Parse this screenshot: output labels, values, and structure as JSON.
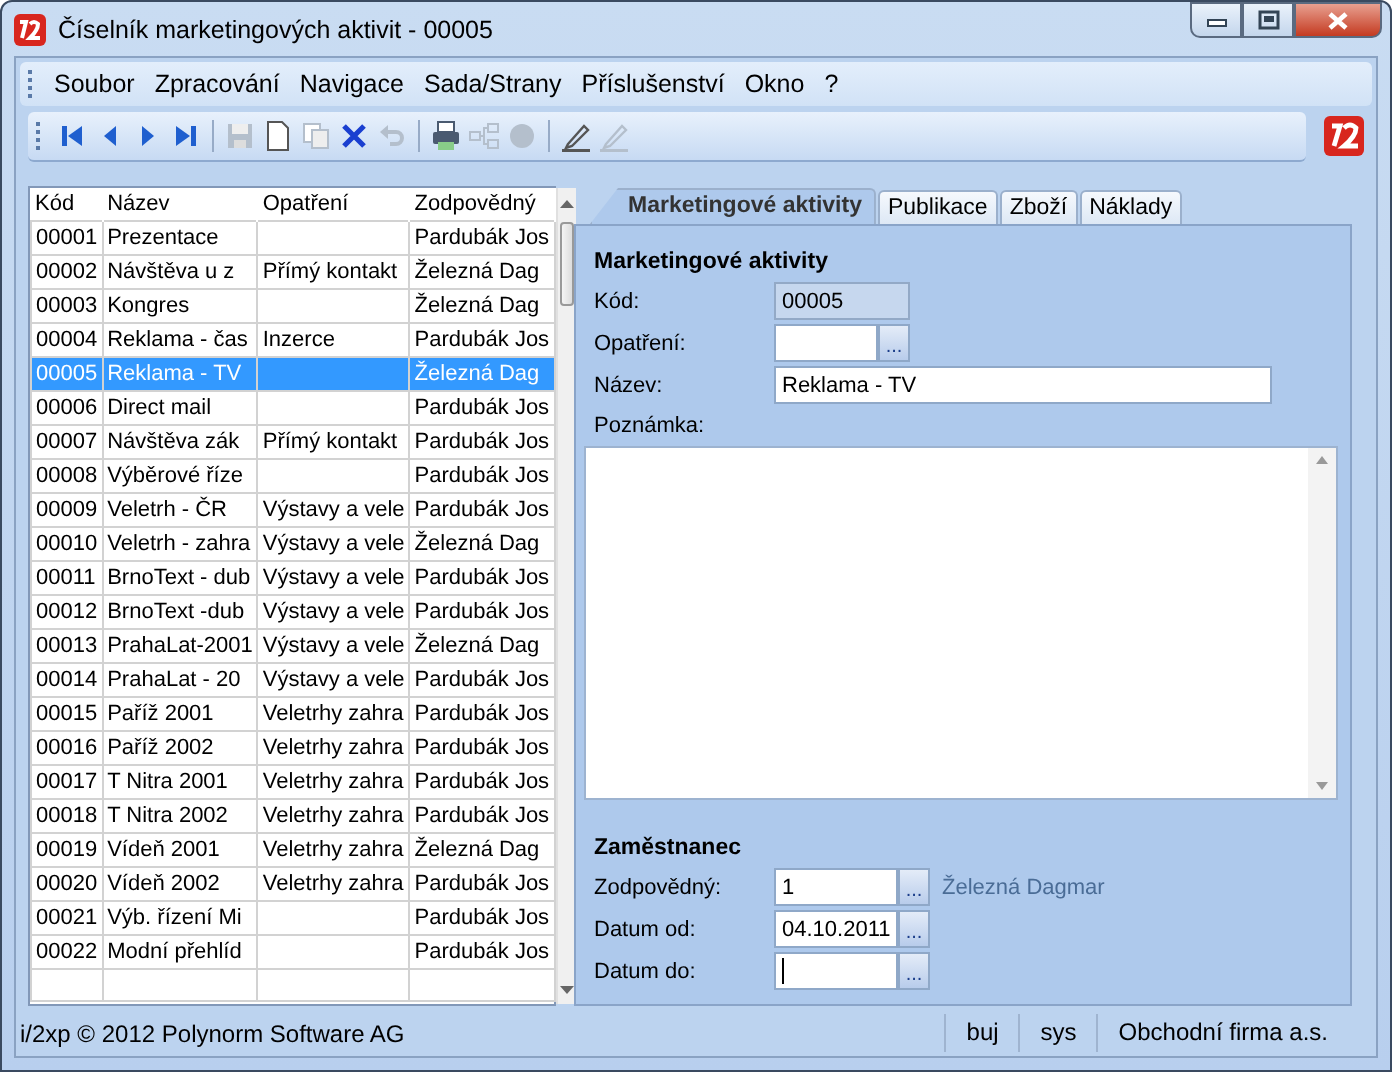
{
  "window": {
    "title": "Číselník marketingových aktivit - 00005"
  },
  "menu": [
    "Soubor",
    "Zpracování",
    "Navigace",
    "Sada/Strany",
    "Příslušenství",
    "Okno",
    "?"
  ],
  "toolbar": [
    [
      {
        "kind": "first",
        "disabled": false
      },
      {
        "kind": "prev",
        "disabled": false
      },
      {
        "kind": "next",
        "disabled": false
      },
      {
        "kind": "last",
        "disabled": false
      }
    ],
    [
      {
        "kind": "save",
        "disabled": true
      },
      {
        "kind": "new",
        "disabled": false
      },
      {
        "kind": "copy",
        "disabled": true
      },
      {
        "kind": "delete",
        "disabled": false
      },
      {
        "kind": "undo",
        "disabled": true
      }
    ],
    [
      {
        "kind": "print",
        "disabled": false
      },
      {
        "kind": "tree",
        "disabled": true
      },
      {
        "kind": "circle",
        "disabled": true
      }
    ],
    [
      {
        "kind": "pen",
        "disabled": false
      },
      {
        "kind": "pen",
        "disabled": true
      }
    ]
  ],
  "grid": {
    "columns": [
      "Kód",
      "Název",
      "Opatření",
      "Zodpovědný"
    ],
    "rows": [
      {
        "cells": [
          "00001",
          "Prezentace",
          "",
          "Pardubák Jos"
        ],
        "selected": false
      },
      {
        "cells": [
          "00002",
          "Návštěva u z",
          "Přímý kontakt",
          "Železná Dag"
        ],
        "selected": false
      },
      {
        "cells": [
          "00003",
          "Kongres",
          "",
          "Železná Dag"
        ],
        "selected": false
      },
      {
        "cells": [
          "00004",
          "Reklama - čas",
          "Inzerce",
          "Pardubák Jos"
        ],
        "selected": false
      },
      {
        "cells": [
          "00005",
          "Reklama - TV",
          "",
          "Železná Dag"
        ],
        "selected": true
      },
      {
        "cells": [
          "00006",
          "Direct mail",
          "",
          "Pardubák Jos"
        ],
        "selected": false
      },
      {
        "cells": [
          "00007",
          "Návštěva zák",
          "Přímý kontakt",
          "Pardubák Jos"
        ],
        "selected": false
      },
      {
        "cells": [
          "00008",
          "Výběrové říze",
          "",
          "Pardubák Jos"
        ],
        "selected": false
      },
      {
        "cells": [
          "00009",
          "Veletrh - ČR",
          "Výstavy a vele",
          "Pardubák Jos"
        ],
        "selected": false
      },
      {
        "cells": [
          "00010",
          "Veletrh - zahra",
          "Výstavy a vele",
          "Železná Dag"
        ],
        "selected": false
      },
      {
        "cells": [
          "00011",
          "BrnoText - dub",
          "Výstavy a vele",
          "Pardubák Jos"
        ],
        "selected": false
      },
      {
        "cells": [
          "00012",
          "BrnoText -dub",
          "Výstavy a vele",
          "Pardubák Jos"
        ],
        "selected": false
      },
      {
        "cells": [
          "00013",
          "PrahaLat-2001",
          "Výstavy a vele",
          "Železná Dag"
        ],
        "selected": false
      },
      {
        "cells": [
          "00014",
          "PrahaLat - 20",
          "Výstavy a vele",
          "Pardubák Jos"
        ],
        "selected": false
      },
      {
        "cells": [
          "00015",
          "Paříž 2001",
          "Veletrhy zahra",
          "Pardubák Jos"
        ],
        "selected": false
      },
      {
        "cells": [
          "00016",
          "Paříž 2002",
          "Veletrhy zahra",
          "Pardubák Jos"
        ],
        "selected": false
      },
      {
        "cells": [
          "00017",
          "T Nitra 2001",
          "Veletrhy zahra",
          "Pardubák Jos"
        ],
        "selected": false
      },
      {
        "cells": [
          "00018",
          "T Nitra 2002",
          "Veletrhy zahra",
          "Pardubák Jos"
        ],
        "selected": false
      },
      {
        "cells": [
          "00019",
          "Vídeň 2001",
          "Veletrhy zahra",
          "Železná Dag"
        ],
        "selected": false
      },
      {
        "cells": [
          "00020",
          "Vídeň 2002",
          "Veletrhy zahra",
          "Pardubák Jos"
        ],
        "selected": false
      },
      {
        "cells": [
          "00021",
          "Výb. řízení Mi",
          "",
          "Pardubák Jos"
        ],
        "selected": false
      },
      {
        "cells": [
          "00022",
          "Modní přehlíd",
          "",
          "Pardubák Jos"
        ],
        "selected": false
      }
    ]
  },
  "tabs": [
    {
      "label": "Marketingové aktivity",
      "selected": true
    },
    {
      "label": "Publikace",
      "selected": false
    },
    {
      "label": "Zboží",
      "selected": false
    },
    {
      "label": "Náklady",
      "selected": false
    }
  ],
  "form": {
    "section": "Marketingové aktivity",
    "fields": [
      {
        "label": "Kód:",
        "value": "00005",
        "kind": "readonly"
      },
      {
        "label": "Opatření:",
        "kind": "lookup",
        "button": "..."
      },
      {
        "label": "Název:",
        "value": "Reklama - TV",
        "kind": "text"
      }
    ],
    "note_label": "Poznámka:",
    "employee_section": "Zaměstnanec",
    "employee_fields": [
      {
        "label": "Zodpovědný:",
        "value": "1",
        "kind": "lookup",
        "button": "...",
        "name": "Železná Dagmar"
      },
      {
        "label": "Datum od:",
        "value": "04.10.2011",
        "kind": "lookup",
        "button": "..."
      },
      {
        "label": "Datum do:",
        "kind": "lookup",
        "button": "...",
        "focused": true
      }
    ]
  },
  "status_bar": {
    "copyright": "i/2xp © 2012 Polynorm Software AG",
    "user": "buj",
    "database": "sys",
    "company": "Obchodní firma a.s."
  }
}
